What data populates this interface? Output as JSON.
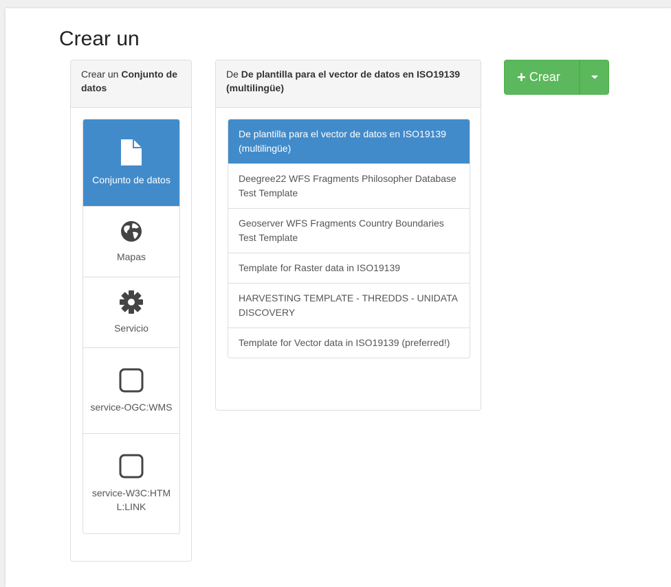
{
  "page": {
    "title": "Crear un"
  },
  "type_panel": {
    "heading_prefix": "Crear un ",
    "heading_strong": "Conjunto de datos",
    "items": [
      {
        "label": "Conjunto de datos",
        "icon": "file-icon",
        "active": true
      },
      {
        "label": "Mapas",
        "icon": "globe-icon",
        "active": false
      },
      {
        "label": "Servicio",
        "icon": "gear-icon",
        "active": false
      },
      {
        "label": "service-OGC:WMS",
        "icon": "square-icon",
        "active": false
      },
      {
        "label": "service-W3C:HTML:LINK",
        "icon": "square-icon",
        "active": false
      }
    ]
  },
  "template_panel": {
    "heading_prefix": "De ",
    "heading_strong": "De plantilla para el vector de datos en ISO19139 (multilingüe)",
    "items": [
      {
        "label": "De plantilla para el vector de datos en ISO19139 (multilingüe)",
        "active": true
      },
      {
        "label": "Deegree22 WFS Fragments Philosopher Database Test Template",
        "active": false
      },
      {
        "label": "Geoserver WFS Fragments Country Boundaries Test Template",
        "active": false
      },
      {
        "label": "Template for Raster data in ISO19139",
        "active": false
      },
      {
        "label": "HARVESTING TEMPLATE - THREDDS - UNIDATA DISCOVERY",
        "active": false
      },
      {
        "label": "Template for Vector data in ISO19139 (preferred!)",
        "active": false
      }
    ]
  },
  "create_button": {
    "label": "Crear",
    "icon": "plus-icon",
    "dropdown_icon": "caret-down-icon"
  },
  "colors": {
    "primary": "#428bca",
    "success": "#5cb85c"
  }
}
